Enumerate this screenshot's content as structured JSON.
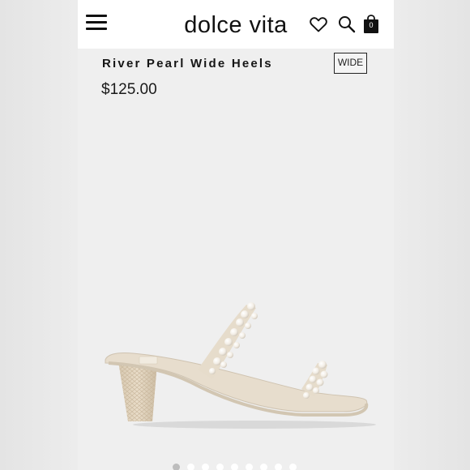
{
  "header": {
    "brand": "dolce vita",
    "bag_count": "0",
    "icons": [
      "menu-icon",
      "heart-icon",
      "search-icon",
      "shopping-bag-icon"
    ]
  },
  "product": {
    "title": "River Pearl Wide Heels",
    "width_badge": "WIDE",
    "price": "$125.00"
  },
  "gallery": {
    "total_images": 9,
    "active_index": 0
  },
  "colors": {
    "background": "#efefef",
    "header_background": "#ffffff",
    "text": "#151515",
    "shoe_leather": "#e6dccb",
    "active_dot": "#bdbdbd"
  }
}
